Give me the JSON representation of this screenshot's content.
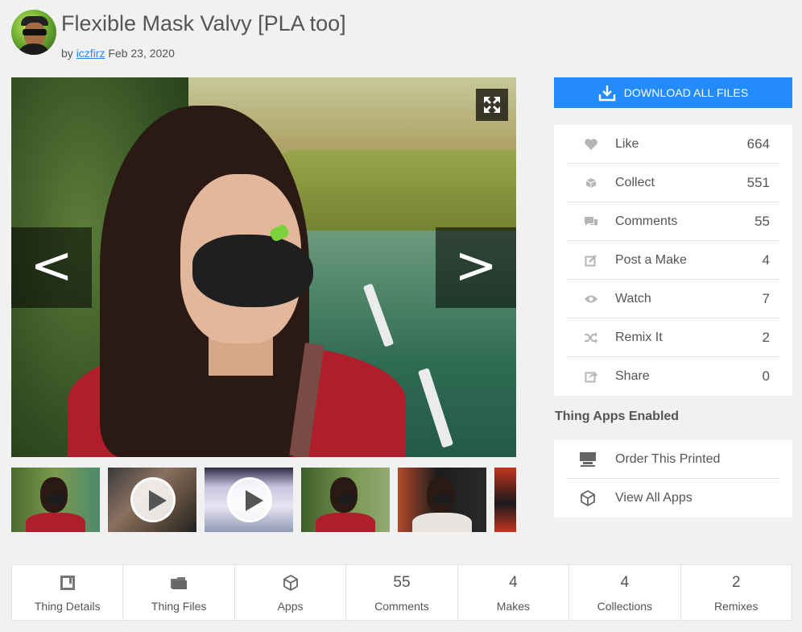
{
  "header": {
    "title": "Flexible Mask Valvy [PLA too]",
    "by_label": "by",
    "author": "iczfirz",
    "date": "Feb 23, 2020"
  },
  "gallery": {
    "prev_label": "<",
    "next_label": ">",
    "expand_icon": "expand-icon",
    "thumbnails": [
      {
        "kind": "photo"
      },
      {
        "kind": "video"
      },
      {
        "kind": "video"
      },
      {
        "kind": "photo"
      },
      {
        "kind": "photo"
      },
      {
        "kind": "photo"
      }
    ]
  },
  "download": {
    "label": "DOWNLOAD ALL FILES",
    "icon": "download-icon"
  },
  "stats": [
    {
      "icon": "heart-icon",
      "label": "Like",
      "count": "664"
    },
    {
      "icon": "collect-icon",
      "label": "Collect",
      "count": "551"
    },
    {
      "icon": "comments-icon",
      "label": "Comments",
      "count": "55"
    },
    {
      "icon": "post-make-icon",
      "label": "Post a Make",
      "count": "4"
    },
    {
      "icon": "eye-icon",
      "label": "Watch",
      "count": "7"
    },
    {
      "icon": "remix-icon",
      "label": "Remix It",
      "count": "2"
    },
    {
      "icon": "share-icon",
      "label": "Share",
      "count": "0"
    }
  ],
  "apps": {
    "heading": "Thing Apps Enabled",
    "items": [
      {
        "icon": "printer-icon",
        "label": "Order This Printed"
      },
      {
        "icon": "cube-icon",
        "label": "View All Apps"
      }
    ]
  },
  "tabs": [
    {
      "icon": "details-icon",
      "value": "",
      "label": "Thing Details"
    },
    {
      "icon": "folder-icon",
      "value": "",
      "label": "Thing Files"
    },
    {
      "icon": "cube-icon",
      "value": "",
      "label": "Apps"
    },
    {
      "icon": "",
      "value": "55",
      "label": "Comments"
    },
    {
      "icon": "",
      "value": "4",
      "label": "Makes"
    },
    {
      "icon": "",
      "value": "4",
      "label": "Collections"
    },
    {
      "icon": "",
      "value": "2",
      "label": "Remixes"
    }
  ],
  "colors": {
    "accent": "#248bfb",
    "background": "#f1f1f1",
    "text": "#555555"
  }
}
